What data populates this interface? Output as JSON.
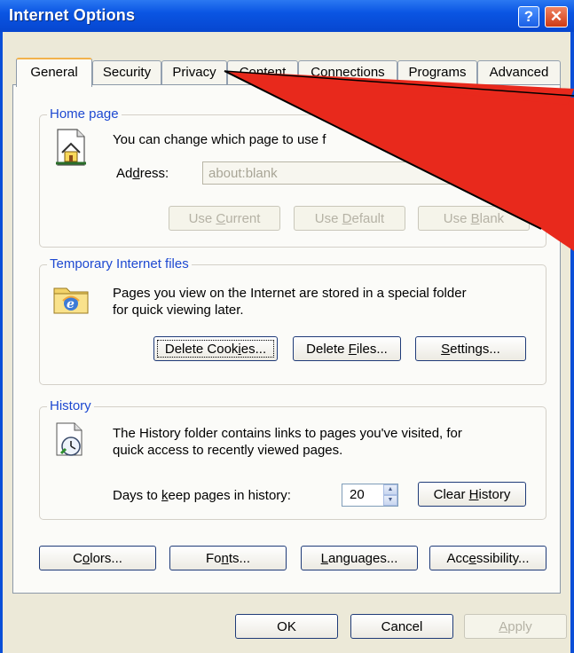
{
  "window": {
    "title": "Internet Options",
    "help_glyph": "?",
    "close_glyph": "✕"
  },
  "tabs": [
    {
      "label": "General"
    },
    {
      "label": "Security"
    },
    {
      "label": "Privacy"
    },
    {
      "label": "Content"
    },
    {
      "label": "Connections"
    },
    {
      "label": "Programs"
    },
    {
      "label": "Advanced"
    }
  ],
  "home_page": {
    "group_label": "Home page",
    "description": "You can change which page to use f",
    "address_label": "Address:",
    "address_value": "about:blank",
    "use_current": "Use Current",
    "use_default": "Use Default",
    "use_blank": "Use Blank"
  },
  "temp_files": {
    "group_label": "Temporary Internet files",
    "description_line1": "Pages you view on the Internet are stored in a special folder",
    "description_line2": "for quick viewing later.",
    "delete_cookies": "Delete Cookies...",
    "delete_files": "Delete Files...",
    "settings": "Settings..."
  },
  "history": {
    "group_label": "History",
    "description_line1": "The History folder contains links to pages you've visited, for",
    "description_line2": "quick access to recently viewed pages.",
    "days_label": "Days to keep pages in history:",
    "days_value": "20",
    "clear_history": "Clear History"
  },
  "bottom_buttons": {
    "colors": "Colors...",
    "fonts": "Fonts...",
    "languages": "Languages...",
    "accessibility": "Accessibility..."
  },
  "dialog_buttons": {
    "ok": "OK",
    "cancel": "Cancel",
    "apply": "Apply"
  },
  "annotation": {
    "arrow_color": "#e8291c"
  }
}
